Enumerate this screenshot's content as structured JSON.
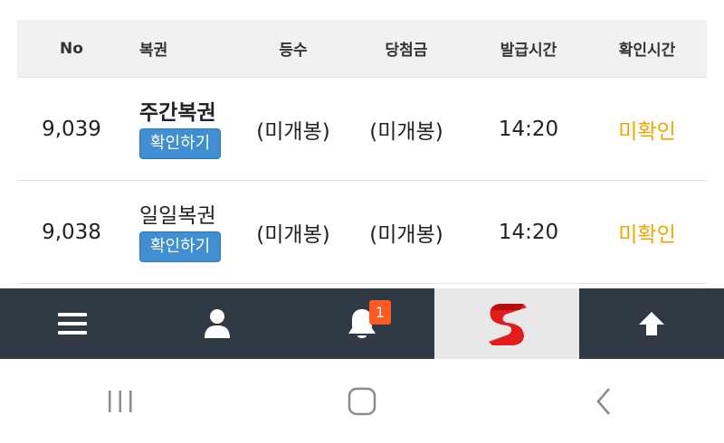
{
  "table": {
    "headers": {
      "no": "No",
      "name": "복권",
      "rank": "등수",
      "prize": "당첨금",
      "issue_time": "발급시간",
      "check_time": "확인시간"
    },
    "rows": [
      {
        "no": "9,039",
        "name": "주간복권",
        "check_button": "확인하기",
        "rank": "(미개봉)",
        "prize": "(미개봉)",
        "issue_time": "14:20",
        "check_time": "미확인"
      },
      {
        "no": "9,038",
        "name": "일일복권",
        "check_button": "확인하기",
        "rank": "(미개봉)",
        "prize": "(미개봉)",
        "issue_time": "14:20",
        "check_time": "미확인"
      }
    ]
  },
  "bottom_nav": {
    "items": [
      {
        "icon": "menu-icon"
      },
      {
        "icon": "user-icon"
      },
      {
        "icon": "bell-icon",
        "badge": "1"
      },
      {
        "icon": "logo-s-icon"
      },
      {
        "icon": "arrow-up-icon"
      }
    ]
  },
  "system_nav": {
    "items": [
      {
        "icon": "recent-apps-icon"
      },
      {
        "icon": "home-icon"
      },
      {
        "icon": "back-icon"
      }
    ]
  },
  "colors": {
    "nav_bg": "#2f3a44",
    "button_blue": "#3f8fd2",
    "unconfirmed": "#f0a400",
    "badge": "#ff5a1f"
  }
}
